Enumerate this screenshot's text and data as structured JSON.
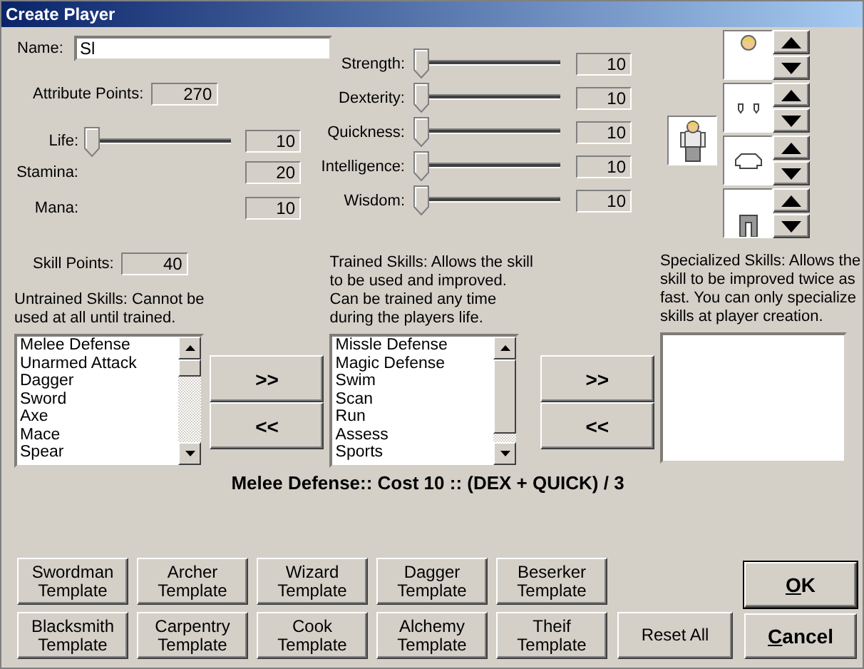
{
  "window": {
    "title": "Create Player"
  },
  "name": {
    "label": "Name:",
    "value": "Sl"
  },
  "attribute_points": {
    "label": "Attribute Points:",
    "value": "270"
  },
  "pools": [
    {
      "label": "Life:",
      "kind": "slider",
      "level": 0,
      "value": "10"
    },
    {
      "label": "Stamina:",
      "kind": "plain",
      "value": "20"
    },
    {
      "label": "Mana:",
      "kind": "plain",
      "value": "10"
    }
  ],
  "attributes": [
    {
      "label": "Strength:",
      "level": 0,
      "value": "10"
    },
    {
      "label": "Dexterity:",
      "level": 0,
      "value": "10"
    },
    {
      "label": "Quickness:",
      "level": 0,
      "value": "10"
    },
    {
      "label": "Intelligence:",
      "level": 0,
      "value": "10"
    },
    {
      "label": "Wisdom:",
      "level": 0,
      "value": "10"
    }
  ],
  "appearance": {
    "slots": [
      {
        "kind": "head"
      },
      {
        "kind": "hands"
      },
      {
        "kind": "torso"
      },
      {
        "kind": "legs"
      }
    ]
  },
  "skill_points": {
    "label": "Skill Points:",
    "value": "40"
  },
  "untrained": {
    "label": "Untrained Skills: Cannot be\nused at all until trained.",
    "items": [
      "Melee Defense",
      "Unarmed Attack",
      "Dagger",
      "Sword",
      "Axe",
      "Mace",
      "Spear"
    ]
  },
  "train_buttons": [
    ">>",
    "<<"
  ],
  "trained": {
    "label": "Trained Skills: Allows the skill\nto be used and improved.\nCan be trained any time\nduring the players life.",
    "items": [
      "Missle Defense",
      "Magic Defense",
      "Swim",
      "Scan",
      "Run",
      "Assess",
      "Sports"
    ]
  },
  "specialize_buttons": [
    ">>",
    "<<"
  ],
  "specialized": {
    "label": "Specialized Skills: Allows the\nskill to be improved twice as\nfast. You can only specialize\nskills at player creation."
  },
  "summary": "Melee Defense:: Cost 10 :: (DEX + QUICK) / 3",
  "templates": [
    "Swordman Template",
    "Archer Template",
    "Wizard Template",
    "Dagger Template",
    "Beserker Template",
    "Blacksmith Template",
    "Carpentry Template",
    "Cook Template",
    "Alchemy Template",
    "Theif Template"
  ],
  "reset_button": "Reset All",
  "ok_button": "OK",
  "cancel_button": "Cancel"
}
